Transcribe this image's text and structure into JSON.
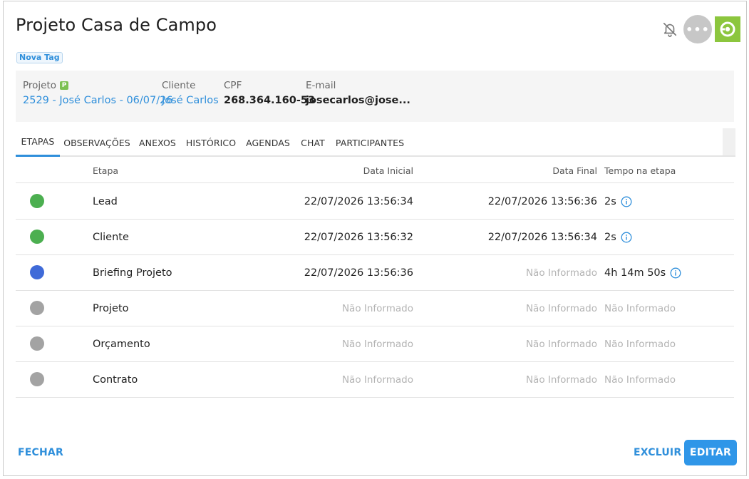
{
  "header": {
    "title": "Projeto Casa de Campo",
    "tag": "Nova Tag",
    "more_label": "•••"
  },
  "info": {
    "projeto": {
      "label": "Projeto",
      "badge": "P",
      "value": "2529 - José Carlos - 06/07/26"
    },
    "cliente": {
      "label": "Cliente",
      "value": "José Carlos"
    },
    "cpf": {
      "label": "CPF",
      "value": "268.364.160-53"
    },
    "email": {
      "label": "E-mail",
      "value": "josecarlos@jose..."
    }
  },
  "tabs": [
    {
      "label": "ETAPAS",
      "active": true
    },
    {
      "label": "OBSERVAÇÕES"
    },
    {
      "label": "ANEXOS"
    },
    {
      "label": "HISTÓRICO"
    },
    {
      "label": "AGENDAS"
    },
    {
      "label": "CHAT"
    },
    {
      "label": "PARTICIPANTES"
    }
  ],
  "table": {
    "headers": {
      "stage": "Etapa",
      "start": "Data Inicial",
      "end": "Data Final",
      "time": "Tempo na etapa"
    },
    "rows": [
      {
        "status_color": "#4caf50",
        "stage": "Lead",
        "start": "22/07/2026 13:56:34",
        "end": "22/07/2026 13:56:36",
        "time": "2s"
      },
      {
        "status_color": "#4caf50",
        "stage": "Cliente",
        "start": "22/07/2026 13:56:32",
        "end": "22/07/2026 13:56:34",
        "time": "2s"
      },
      {
        "status_color": "#3f6ad8",
        "stage": "Briefing Projeto",
        "start": "22/07/2026 13:56:36",
        "end": "Não Informado",
        "time": "4h 14m 50s"
      },
      {
        "status_color": "#a3a3a3",
        "stage": "Projeto",
        "start": "Não Informado",
        "end": "Não Informado",
        "time": "Não Informado"
      },
      {
        "status_color": "#a3a3a3",
        "stage": "Orçamento",
        "start": "Não Informado",
        "end": "Não Informado",
        "time": "Não Informado"
      },
      {
        "status_color": "#a3a3a3",
        "stage": "Contrato",
        "start": "Não Informado",
        "end": "Não Informado",
        "time": "Não Informado"
      }
    ]
  },
  "footer": {
    "close": "FECHAR",
    "delete": "EXCLUIR",
    "edit": "EDITAR"
  },
  "colors": {
    "accent": "#2f8fdb",
    "brand": "#8cc63e"
  },
  "icons": {
    "bell": "bell-off-icon",
    "brand": "brand-logo-icon",
    "info": "info-circle-icon"
  }
}
